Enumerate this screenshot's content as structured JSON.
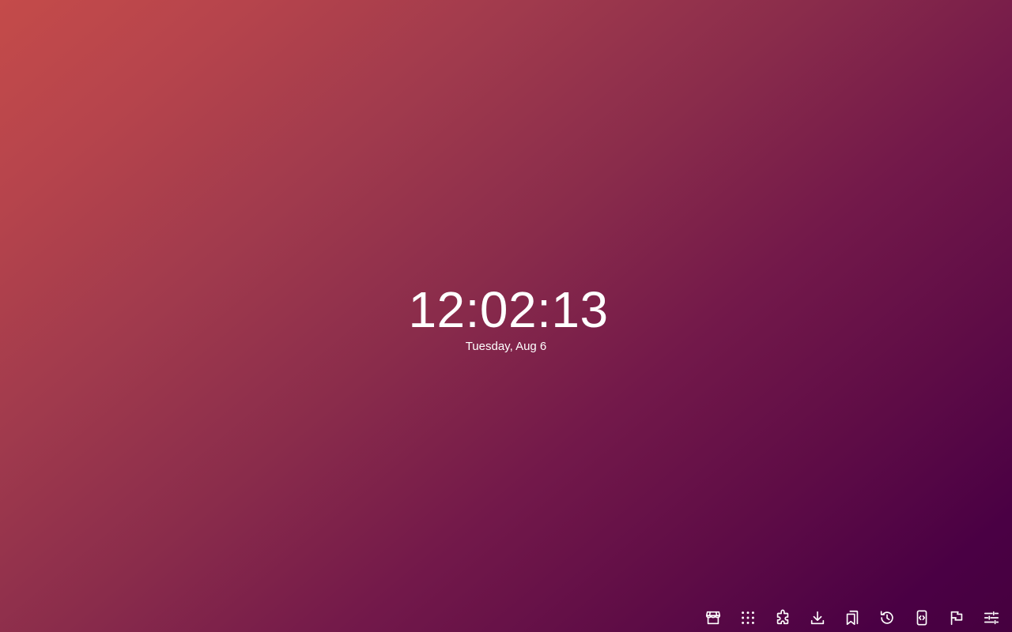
{
  "clock": {
    "time": "12:02:13",
    "date": "Tuesday, Aug 6"
  },
  "background": {
    "gradient_start": "#c44b4a",
    "gradient_end": "#46003f"
  },
  "toolbar": {
    "icons": [
      "store-icon",
      "apps-grid-icon",
      "puzzle-icon",
      "download-icon",
      "bookmarks-icon",
      "history-icon",
      "device-code-icon",
      "flag-icon",
      "sliders-icon"
    ]
  }
}
